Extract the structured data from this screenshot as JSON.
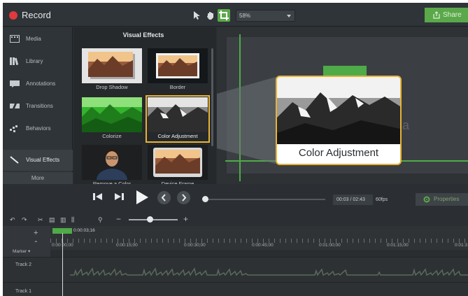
{
  "app": {
    "title": "Record"
  },
  "toolbar": {
    "zoom": "58%",
    "share": "Share"
  },
  "sidebar": {
    "items": [
      {
        "label": "Media",
        "icon": "film-icon"
      },
      {
        "label": "Library",
        "icon": "library-icon"
      },
      {
        "label": "Annotations",
        "icon": "annotation-icon"
      },
      {
        "label": "Transitions",
        "icon": "transition-icon"
      },
      {
        "label": "Behaviors",
        "icon": "behavior-icon"
      },
      {
        "label": "Visual Effects",
        "icon": "wand-icon"
      }
    ],
    "more": "More"
  },
  "effects": {
    "title": "Visual Effects",
    "tiles": [
      {
        "label": "Drop Shadow"
      },
      {
        "label": "Border"
      },
      {
        "label": "Colorize"
      },
      {
        "label": "Color Adjustment"
      },
      {
        "label": "Remove a Color"
      },
      {
        "label": "Device Frame"
      }
    ]
  },
  "canvas": {
    "callout_label": "Color Adjustment",
    "ghost_text": "ia"
  },
  "player": {
    "time": "00:03 / 02:43",
    "fps": "60fps",
    "properties": "Properties"
  },
  "timeline": {
    "playhead": "0:00:03;16",
    "ruler": [
      "0:00:00;00",
      "0:00:15;00",
      "0:00:30;00",
      "0:00:45;00",
      "0:01:00;00",
      "0:01:15;00",
      "0:01:3"
    ],
    "marker": "Marker",
    "tracks": [
      "Track 2",
      "Track 1"
    ]
  }
}
